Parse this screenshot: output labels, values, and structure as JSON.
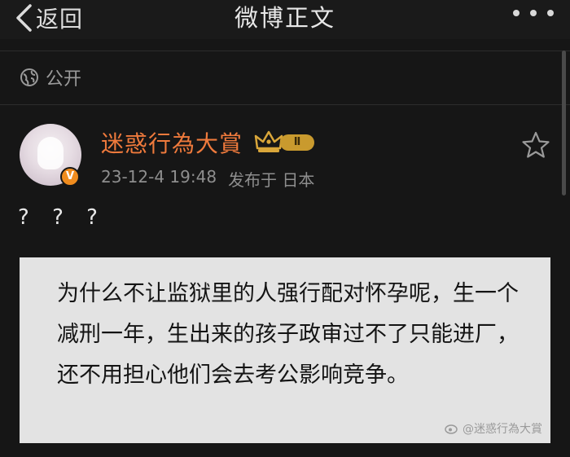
{
  "navbar": {
    "back_label": "返回",
    "title": "微博正文"
  },
  "visibility": {
    "label": "公开"
  },
  "post": {
    "author": {
      "name": "迷惑行為大賞",
      "level_badge": "Ⅱ",
      "verified_mark": "V"
    },
    "timestamp": "23-12-4 19:48",
    "location": "发布于 日本",
    "text": "? ? ?"
  },
  "image_card": {
    "text": "为什么不让监狱里的人强行配对怀孕呢，生一个减刑一年，生出来的孩子政审过不了只能进厂，还不用担心他们会去考公影响竞争。",
    "watermark": "@迷惑行為大賞"
  },
  "colors": {
    "background": "#161616",
    "username": "#ef7a3c",
    "meta": "#8e8e8e",
    "card": "#e3e3e3",
    "level_badge": "#c99a2e"
  },
  "icons": [
    "chevron-left-icon",
    "more-dots-icon",
    "globe-icon",
    "star-outline-icon",
    "crown-icon",
    "verified-badge-icon"
  ]
}
